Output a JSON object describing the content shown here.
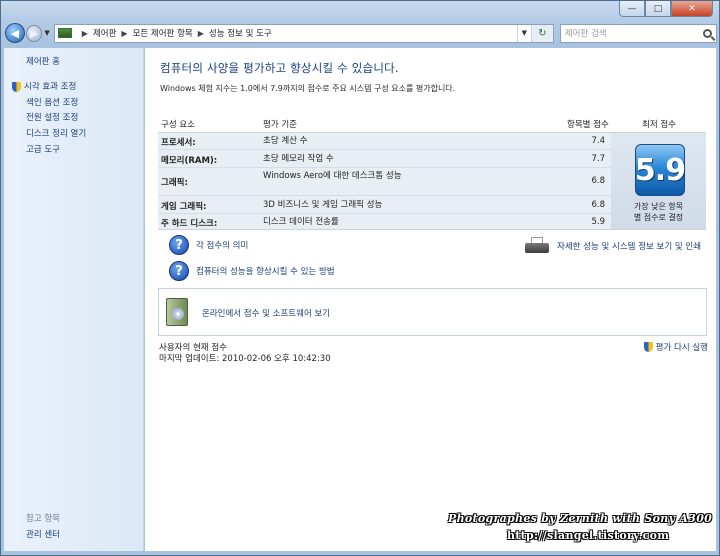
{
  "window": {
    "caption_buttons": [
      "—",
      "□",
      "✕"
    ]
  },
  "navbar": {
    "back_glyph": "◀",
    "forward_glyph": "▶",
    "breadcrumb": [
      "제어판",
      "모든 제어판 항목",
      "성능 정보 및 도구"
    ],
    "search_placeholder": "제어판 검색",
    "icons": [
      "back-icon",
      "forward-icon",
      "control-panel-icon",
      "refresh-icon",
      "search-icon"
    ]
  },
  "sidebar": {
    "home": "제어판 홈",
    "items": [
      "시각 효과 조정",
      "색인 옵션 조정",
      "전원 설정 조정",
      "디스크 정리 열기",
      "고급 도구"
    ],
    "see_also_heading": "참고 항목",
    "see_also_items": [
      "관리 센터"
    ]
  },
  "main": {
    "heading": "컴퓨터의 사양을 평가하고 향상시킬 수 있습니다.",
    "subtext": "Windows 체험 지수는 1.0에서 7.9까지의 점수로 주요 시스템 구성 요소를 평가합니다.",
    "columns": {
      "component": "구성 요소",
      "criteria": "평가 기준",
      "subscore": "항목별 점수",
      "base_score": "최저 점수"
    },
    "rows": [
      {
        "name": "프로세서:",
        "desc": "초당 계산 수",
        "score": "7.4"
      },
      {
        "name": "메모리(RAM):",
        "desc": "초당 메모리 작업 수",
        "score": "7.7"
      },
      {
        "name": "그래픽:",
        "desc": "Windows Aero에 대한 데스크톱 성능",
        "score": "6.8"
      },
      {
        "name": "게임 그래픽:",
        "desc": "3D 비즈니스 및 게임 그래픽 성능",
        "score": "6.8"
      },
      {
        "name": "주 하드 디스크:",
        "desc": "디스크 데이터 전송률",
        "score": "5.9"
      }
    ],
    "base": {
      "score": "5.9",
      "caption_line1": "가장 낮은 항목",
      "caption_line2": "별 점수로 결정"
    },
    "links": {
      "score_meaning": "각 점수의 의미",
      "improve": "컴퓨터의 성능을 향상시킬 수 있는 방법",
      "details": "자세한 성능 및 시스템 정보 보기 및 인쇄",
      "online": "온라인에서 점수 및 소프트웨어 보기"
    },
    "status": {
      "current": "사용자의 현재 점수",
      "last_update": "마지막 업데이트: 2010-02-06 오후 10:42:30"
    },
    "rerun": "평가 다시 실행"
  },
  "watermark": {
    "line1": "Photographes by Zernith with Sony A300",
    "line2": "http://slangel.tistory.com"
  }
}
